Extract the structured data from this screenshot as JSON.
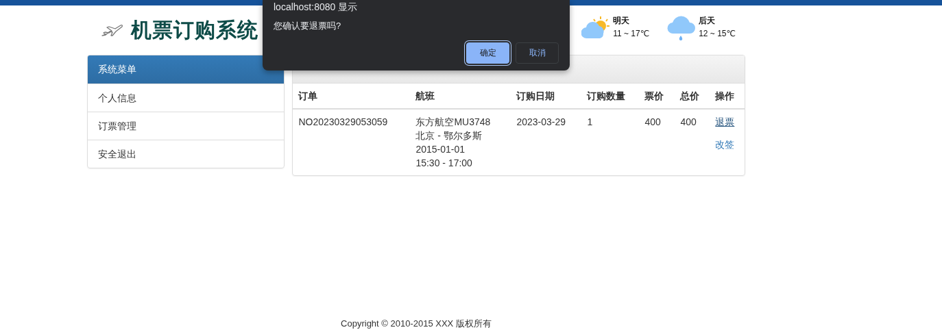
{
  "header": {
    "title": "机票订购系统",
    "weather": [
      {
        "day": "明天",
        "temp": "11 ~ 17℃",
        "kind": "partly-cloudy"
      },
      {
        "day": "后天",
        "temp": "12 ~ 15℃",
        "kind": "rain"
      }
    ]
  },
  "sidebar": {
    "title": "系统菜单",
    "items": [
      {
        "label": "个人信息"
      },
      {
        "label": "订票管理"
      },
      {
        "label": "安全退出"
      }
    ]
  },
  "panel": {
    "table": {
      "columns": [
        "订单",
        "航班",
        "订购日期",
        "订购数量",
        "票价",
        "总价",
        "操作"
      ],
      "rows": [
        {
          "order": "NO20230329053059",
          "flight": [
            "东方航空MU3748",
            "北京 - 鄂尔多斯",
            "2015-01-01",
            "15:30 - 17:00"
          ],
          "date": "2023-03-29",
          "quantity": "1",
          "price": "400",
          "total": "400",
          "actions": [
            {
              "label": "退票",
              "focused": true
            },
            {
              "label": "改签",
              "focused": false
            }
          ]
        }
      ]
    }
  },
  "footer": {
    "copyright": "Copyright © 2010-2015 XXX 版权所有"
  },
  "dialog": {
    "title": "localhost:8080 显示",
    "message": "您确认要退票吗?",
    "buttons": [
      {
        "label": "确定",
        "primary": true
      },
      {
        "label": "取消",
        "primary": false
      }
    ]
  }
}
